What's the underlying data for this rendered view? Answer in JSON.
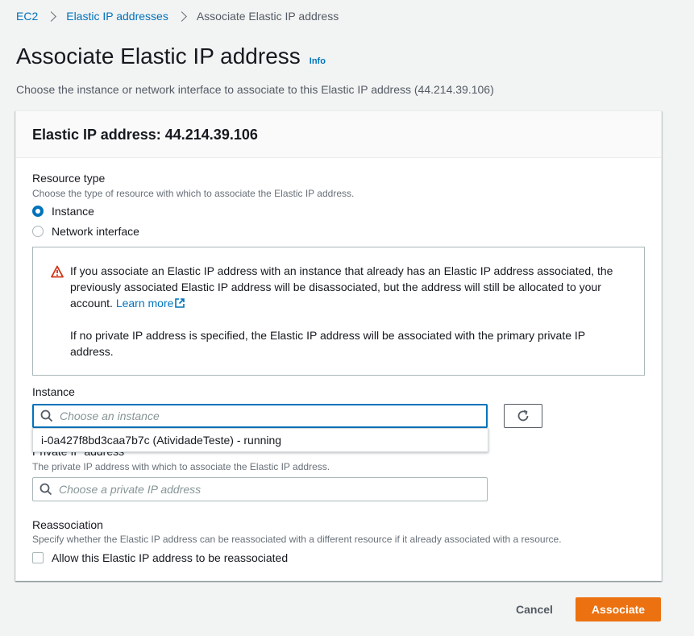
{
  "breadcrumb": {
    "items": [
      "EC2",
      "Elastic IP addresses"
    ],
    "current": "Associate Elastic IP address"
  },
  "page": {
    "title": "Associate Elastic IP address",
    "info": "Info",
    "description": "Choose the instance or network interface to associate to this Elastic IP address (44.214.39.106)"
  },
  "panel": {
    "header": "Elastic IP address: 44.214.39.106"
  },
  "resource_type": {
    "label": "Resource type",
    "description": "Choose the type of resource with which to associate the Elastic IP address.",
    "options": [
      "Instance",
      "Network interface"
    ],
    "selected": "Instance"
  },
  "alert": {
    "text1": "If you associate an Elastic IP address with an instance that already has an Elastic IP address associated, the previously associated Elastic IP address will be disassociated, but the address will still be allocated to your account.",
    "link": "Learn more",
    "text2": "If no private IP address is specified, the Elastic IP address will be associated with the primary private IP address."
  },
  "instance": {
    "label": "Instance",
    "placeholder": "Choose an instance",
    "dropdown_option": "i-0a427f8bd3caa7b7c (AtividadeTeste) - running"
  },
  "private_ip": {
    "label": "Private IP address",
    "description": "The private IP address with which to associate the Elastic IP address.",
    "placeholder": "Choose a private IP address"
  },
  "reassociation": {
    "label": "Reassociation",
    "description": "Specify whether the Elastic IP address can be reassociated with a different resource if it already associated with a resource.",
    "checkbox_label": "Allow this Elastic IP address to be reassociated",
    "checked": false
  },
  "footer": {
    "cancel": "Cancel",
    "associate": "Associate"
  },
  "colors": {
    "link": "#0073bb",
    "primary_button": "#ec7211",
    "warning": "#d13212"
  }
}
